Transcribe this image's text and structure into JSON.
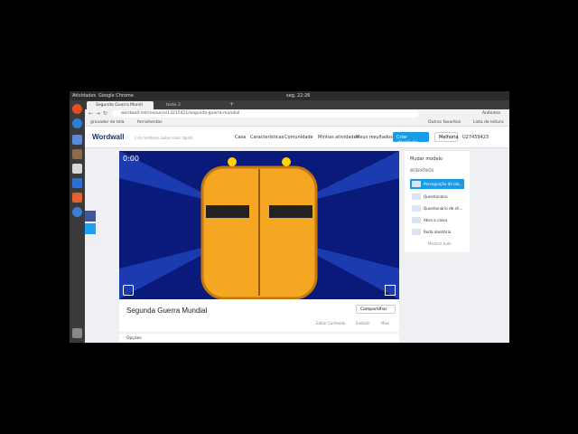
{
  "topbar": {
    "activities": "Atividades",
    "app": "Google Chrome",
    "clock": "seg, 22:26"
  },
  "tabs": [
    {
      "label": "Segunda Guerra Mundi"
    },
    {
      "label": "teste 3"
    }
  ],
  "address": {
    "url": "wordwall.net/resource/13215421/segunda-guerra-mundial",
    "profile": "Anônima"
  },
  "bookmarks": {
    "item1": "gravador de tela",
    "item2": "ferramentas",
    "other": "Outros favoritos",
    "reading": "Lista de leitura"
  },
  "site": {
    "logo": "Wordwall",
    "tagline": "Cria melhores aulas mais rápido",
    "nav": [
      "Casa",
      "Características",
      "Comunidade",
      "Minhas atividades",
      "Meus resultados"
    ],
    "create": "Criar atividade",
    "upgrade": "Melhoria",
    "user": "U27459423"
  },
  "game": {
    "timer": "0:00"
  },
  "activity": {
    "title": "Segunda Guerra Mundial",
    "share": "Compartilhar",
    "edit": "Editar Conteúdo",
    "embed": "Embutir",
    "more": "Mais",
    "below": "Opções"
  },
  "templates": {
    "heading": "Mudar modelo",
    "section": "INTERATIVOS",
    "items": [
      "Perseguição de lab...",
      "Questionário",
      "Questionário de sh...",
      "Abra a caixa",
      "Roda aleatória"
    ],
    "more": "Mostrar tudo"
  },
  "colors": {
    "accent": "#1a9be8",
    "game_bg": "#0a1a7a",
    "door": "#f5a623"
  }
}
